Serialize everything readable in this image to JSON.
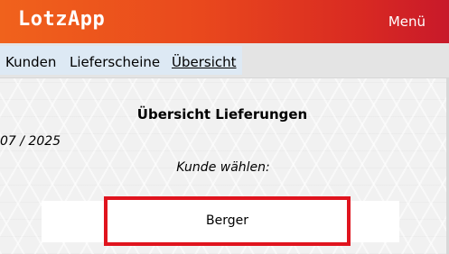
{
  "header": {
    "app_title": "LotzApp",
    "menu_label": "Menü"
  },
  "nav": {
    "items": [
      {
        "label": "Kunden"
      },
      {
        "label": "Lieferscheine"
      },
      {
        "label": "Übersicht",
        "active": true
      }
    ]
  },
  "main": {
    "title": "Übersicht Lieferungen",
    "date_fragment": "07 / 2025",
    "choose_label": "Kunde wählen:",
    "selected_customer": "Berger"
  },
  "colors": {
    "header_gradient_start": "#f0621c",
    "header_gradient_end": "#c8192a",
    "highlight_border": "#e0141e",
    "nav_strip": "#dde9f4"
  }
}
